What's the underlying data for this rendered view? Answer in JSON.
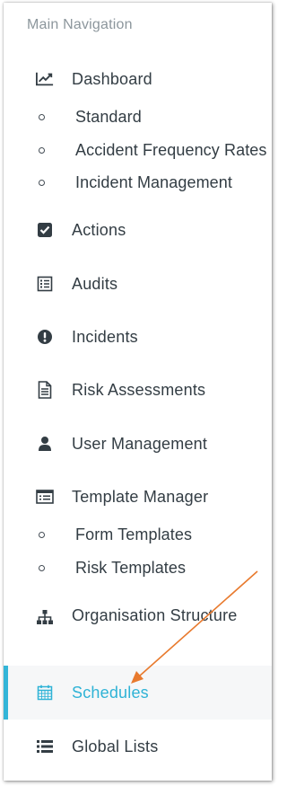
{
  "nav": {
    "heading": "Main Navigation",
    "dashboard": {
      "label": "Dashboard",
      "icon": "line-chart-icon",
      "children": [
        "Standard",
        "Accident Frequency Rates",
        "Incident Management"
      ]
    },
    "actions": {
      "label": "Actions",
      "icon": "check-square-icon"
    },
    "audits": {
      "label": "Audits",
      "icon": "checklist-icon"
    },
    "incidents": {
      "label": "Incidents",
      "icon": "exclamation-circle-icon"
    },
    "risk_assessments": {
      "label": "Risk Assessments",
      "icon": "document-icon"
    },
    "user_management": {
      "label": "User Management",
      "icon": "user-icon"
    },
    "template_manager": {
      "label": "Template Manager",
      "icon": "list-alt-icon",
      "children": [
        "Form Templates",
        "Risk Templates"
      ]
    },
    "organisation_structure": {
      "label": "Organisation Structure",
      "icon": "sitemap-icon"
    },
    "schedules": {
      "label": "Schedules",
      "icon": "calendar-icon",
      "active": true
    },
    "global_lists": {
      "label": "Global Lists",
      "icon": "list-icon"
    }
  },
  "colors": {
    "text": "#333d44",
    "heading": "#8c969c",
    "accent": "#2fb3d6",
    "annotation_arrow": "#e87a2e"
  }
}
